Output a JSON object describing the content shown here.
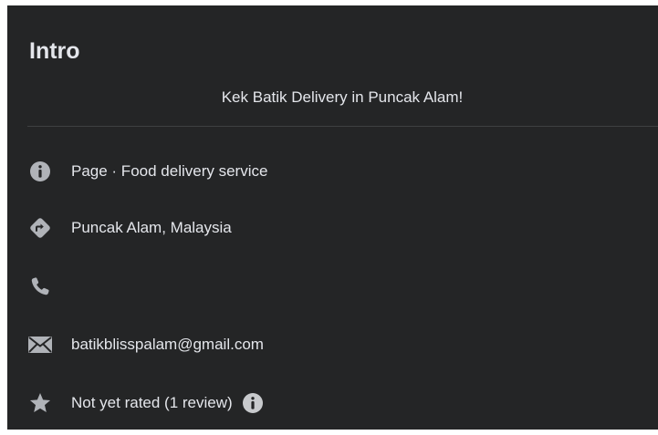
{
  "intro": {
    "title": "Intro",
    "bio": "Kek Batik Delivery in Puncak Alam!"
  },
  "details": {
    "category": {
      "text": "Page · Food delivery service",
      "icon": "info-icon"
    },
    "location": {
      "text": "Puncak Alam, Malaysia",
      "icon": "directions-icon"
    },
    "phone": {
      "text": "",
      "icon": "phone-icon"
    },
    "email": {
      "text": "batikblisspalam@gmail.com",
      "icon": "envelope-icon"
    },
    "rating": {
      "text": "Not yet rated (1 review)",
      "icon": "star-icon",
      "info_icon": "info-icon"
    }
  },
  "colors": {
    "background": "#242526",
    "text": "#e4e6eb",
    "icon": "#b0b3b8",
    "divider": "#3e4042"
  }
}
